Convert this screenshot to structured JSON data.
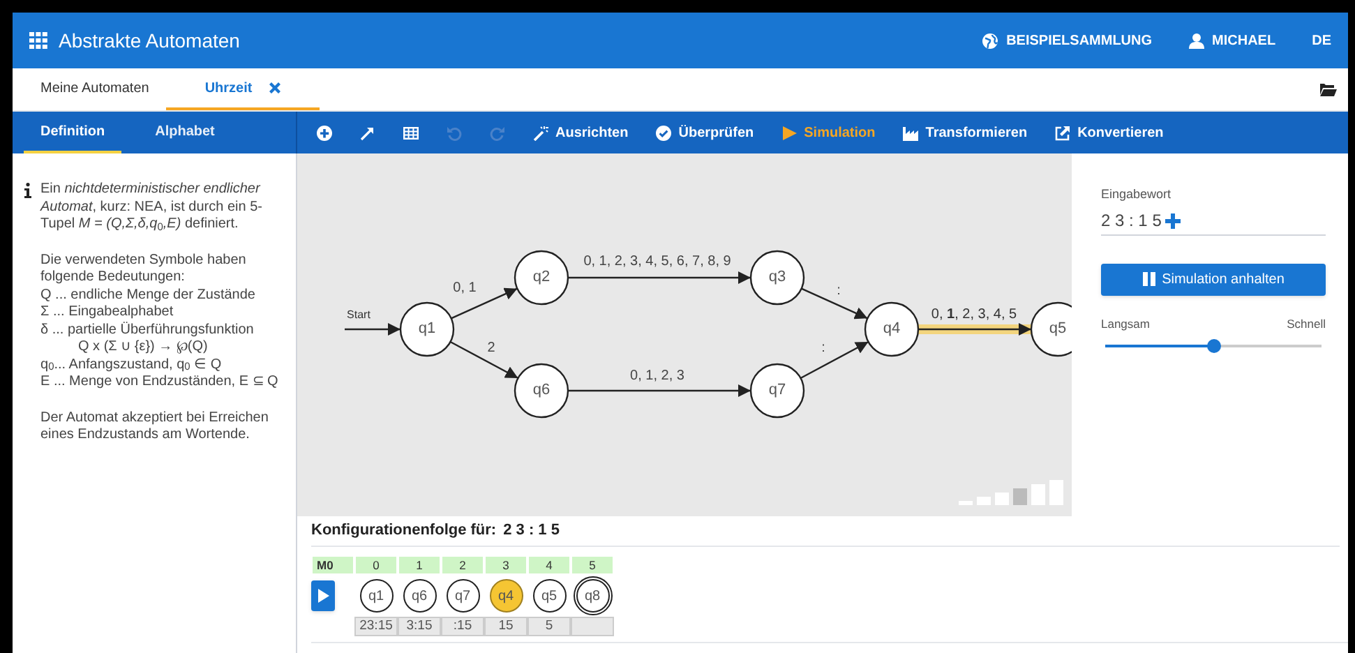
{
  "header": {
    "title": "Abstrakte Automaten",
    "links": [
      {
        "label": "BEISPIELSAMMLUNG",
        "kind": "globe"
      },
      {
        "label": "MICHAEL",
        "kind": "user"
      },
      {
        "label": "DE",
        "kind": "text"
      }
    ]
  },
  "tabs": [
    {
      "label": "Meine Automaten",
      "selected": false,
      "closable": false
    },
    {
      "label": "Uhrzeit",
      "selected": true,
      "closable": true
    }
  ],
  "side_tabs": [
    {
      "label": "Definition",
      "selected": true
    },
    {
      "label": "Alphabet",
      "selected": false
    }
  ],
  "toolbar": [
    {
      "kind": "add",
      "disabled": false,
      "selected": false
    },
    {
      "kind": "arrow",
      "disabled": false,
      "selected": false
    },
    {
      "kind": "table",
      "disabled": false,
      "selected": false
    },
    {
      "kind": "undo",
      "disabled": true,
      "selected": false
    },
    {
      "kind": "redo",
      "disabled": true,
      "selected": false
    },
    {
      "kind": "align",
      "label": "Ausrichten",
      "disabled": false,
      "selected": false
    },
    {
      "kind": "check",
      "label": "Überprüfen",
      "disabled": false,
      "selected": false
    },
    {
      "kind": "simulate",
      "label": "Simulation",
      "disabled": false,
      "selected": true
    },
    {
      "kind": "transform",
      "label": "Transformieren",
      "disabled": false,
      "selected": false
    },
    {
      "kind": "convert",
      "label": "Konvertieren",
      "disabled": false,
      "selected": false
    }
  ],
  "info": {
    "blocks": [
      [
        {
          "kind": "line",
          "text": "Ein *nichtdeterministischer endlicher Automat*, kurz: NEA, ist durch ein 5-Tupel *M = (Q,Σ,δ,q*$_{0}$*,E)* definiert."
        }
      ],
      [
        {
          "kind": "line",
          "text": "Die verwendeten Symbole haben folgende Bedeutungen:"
        },
        {
          "kind": "line",
          "text": "Q ... endliche Menge der Zustände"
        },
        {
          "kind": "line",
          "text": "Σ ... Eingabealphabet"
        },
        {
          "kind": "line",
          "text": "δ ... partielle Überführungsfunktion"
        },
        {
          "kind": "formula",
          "text": "Q x (Σ ∪ {ε}) → ℘(Q)"
        },
        {
          "kind": "line",
          "text": "q$_{0}$... Anfangszustand, q$_{0}$ ∈ Q"
        },
        {
          "kind": "line",
          "text": "E ... Menge von Endzuständen, E ⊆ Q"
        }
      ],
      [
        {
          "kind": "line",
          "text": "Der Automat akzeptiert bei Erreichen eines Endzustands am Wortende."
        }
      ]
    ]
  },
  "graph": {
    "start_label": "Start",
    "nodes": [
      {
        "label": "q1",
        "start": true
      },
      {
        "label": "q2",
        "start": false
      },
      {
        "label": "q3",
        "start": false
      },
      {
        "label": "q4",
        "start": false
      },
      {
        "label": "q5",
        "start": false
      },
      {
        "label": "q6",
        "start": false
      },
      {
        "label": "q7",
        "start": false
      }
    ],
    "edges": [
      {
        "label": "0, 1",
        "highlighted": false
      },
      {
        "label": "2",
        "highlighted": false
      },
      {
        "label": "0, 1, 2, 3, 4, 5, 6, 7, 8, 9",
        "highlighted": false
      },
      {
        "label": "0, 1, 2, 3",
        "highlighted": false
      },
      {
        "label": ":",
        "highlighted": false
      },
      {
        "label": ":",
        "highlighted": false
      },
      {
        "label": "0, **1**, 2, 3, 4, 5",
        "highlighted": true
      }
    ],
    "zoom_levels": [
      {
        "selected": false
      },
      {
        "selected": false
      },
      {
        "selected": false
      },
      {
        "selected": true
      },
      {
        "selected": false
      },
      {
        "selected": false
      }
    ]
  },
  "simulation": {
    "input_label": "Eingabewort",
    "input_value": "2 3 : 1 5",
    "button": "Simulation anhalten",
    "slow_label": "Langsam",
    "fast_label": "Schnell",
    "speed": {
      "level": 0.5
    }
  },
  "configuration": {
    "title": "Konfigurationenfolge für:",
    "word": "2 3 : 1 5",
    "machine": "M0",
    "steps": [
      {
        "step": "0",
        "state": "q1",
        "rest": "23:15",
        "current": false,
        "final": false
      },
      {
        "step": "1",
        "state": "q6",
        "rest": "3:15",
        "current": false,
        "final": false
      },
      {
        "step": "2",
        "state": "q7",
        "rest": ":15",
        "current": false,
        "final": false
      },
      {
        "step": "3",
        "state": "q4",
        "rest": "15",
        "current": true,
        "final": false
      },
      {
        "step": "4",
        "state": "q5",
        "rest": "5",
        "current": false,
        "final": false
      },
      {
        "step": "5",
        "state": "q8",
        "current": false,
        "final": true
      }
    ]
  }
}
